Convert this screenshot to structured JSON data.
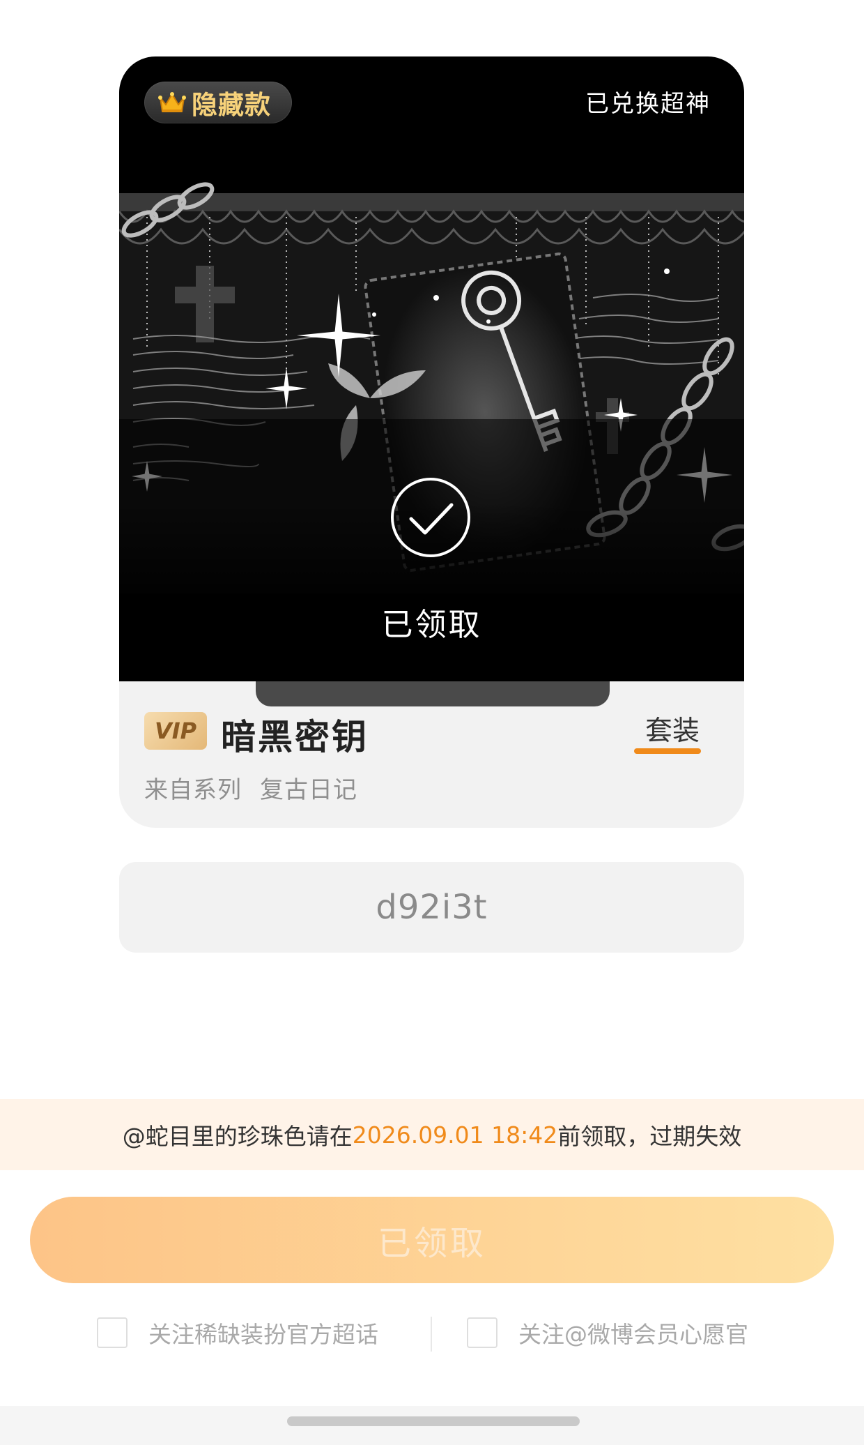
{
  "card": {
    "badge": "隐藏款",
    "redeemed_status": "已兑换超神",
    "claimed_overlay": "已领取",
    "vip_label": "VIP",
    "item_name": "暗黑密钥",
    "set_tag": "套装",
    "series_label": "来自系列",
    "series_name": "复古日记"
  },
  "code": {
    "value": "d92i3t"
  },
  "notice": {
    "prefix": "@蛇目里的珍珠色请在",
    "deadline": "2026.09.01 18:42",
    "suffix": "前领取，过期失效"
  },
  "claim_button": {
    "label": "已领取"
  },
  "options": [
    {
      "label": "关注稀缺装扮官方超话",
      "checked": false
    },
    {
      "label": "关注@微博会员心愿官",
      "checked": false
    }
  ],
  "colors": {
    "accent": "#f08a1a",
    "button_start": "#fdc487",
    "button_end": "#fee0a2",
    "notice_bg": "#fff3e8"
  },
  "icons": [
    "crown-icon",
    "check-circle-icon",
    "key-artwork"
  ]
}
